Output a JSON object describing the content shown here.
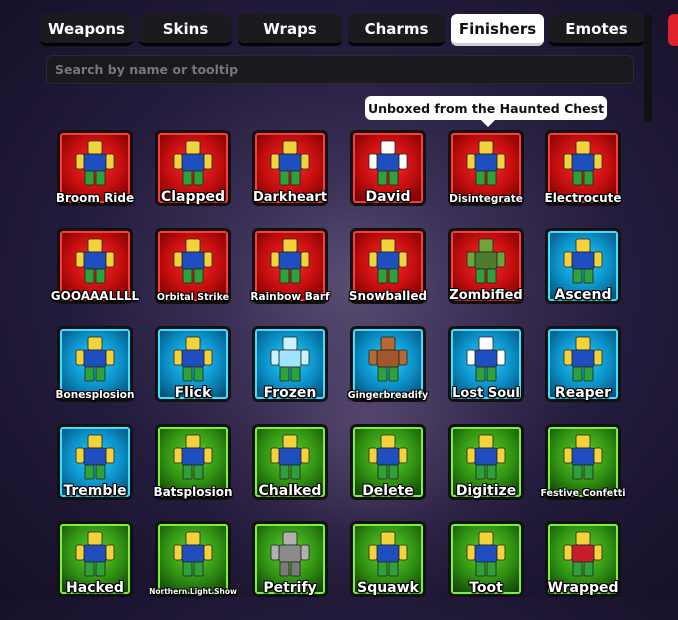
{
  "tabs": [
    {
      "label": "Weapons",
      "active": false
    },
    {
      "label": "Skins",
      "active": false
    },
    {
      "label": "Wraps",
      "active": false
    },
    {
      "label": "Charms",
      "active": false
    },
    {
      "label": "Finishers",
      "active": true
    },
    {
      "label": "Emotes",
      "active": false
    }
  ],
  "search": {
    "placeholder": "Search by name or tooltip",
    "value": ""
  },
  "tooltip": {
    "text": "Unboxed from the Haunted Chest"
  },
  "colors": {
    "red": "#c40e0e",
    "blue": "#0b8fc7",
    "green": "#2f8f12",
    "active_tab": "#ffffff",
    "tab": "#1b1b1f"
  },
  "finishers": [
    {
      "label": "Broom Ride",
      "rarity": "red",
      "icon": "broom-rider-icon"
    },
    {
      "label": "Clapped",
      "rarity": "red",
      "icon": "clapping-hands-icon"
    },
    {
      "label": "Darkheart",
      "rarity": "red",
      "icon": "dark-figure-icon"
    },
    {
      "label": "David",
      "rarity": "red",
      "icon": "snowman-icon"
    },
    {
      "label": "Disintegrate",
      "rarity": "red",
      "icon": "laser-blast-icon"
    },
    {
      "label": "Electrocute",
      "rarity": "red",
      "icon": "lightning-icon"
    },
    {
      "label": "GOOAAALLLL",
      "rarity": "red",
      "icon": "soccer-goal-icon"
    },
    {
      "label": "Orbital Strike",
      "rarity": "red",
      "icon": "orbital-beam-icon"
    },
    {
      "label": "Rainbow Barf",
      "rarity": "red",
      "icon": "rainbow-icon"
    },
    {
      "label": "Snowballed",
      "rarity": "red",
      "icon": "snowball-icon"
    },
    {
      "label": "Zombified",
      "rarity": "red",
      "icon": "zombie-icon"
    },
    {
      "label": "Ascend",
      "rarity": "blue",
      "icon": "ascend-light-icon"
    },
    {
      "label": "Bonesplosion",
      "rarity": "blue",
      "icon": "bones-icon"
    },
    {
      "label": "Flick",
      "rarity": "blue",
      "icon": "flick-hand-icon"
    },
    {
      "label": "Frozen",
      "rarity": "blue",
      "icon": "frozen-figure-icon"
    },
    {
      "label": "Gingerbreadify",
      "rarity": "blue",
      "icon": "gingerbread-icon"
    },
    {
      "label": "Lost Soul",
      "rarity": "blue",
      "icon": "ghost-icon"
    },
    {
      "label": "Reaper",
      "rarity": "blue",
      "icon": "scythe-icon"
    },
    {
      "label": "Tremble",
      "rarity": "blue",
      "icon": "trembling-figure-icon"
    },
    {
      "label": "Batsplosion",
      "rarity": "green",
      "icon": "bat-icon"
    },
    {
      "label": "Chalked",
      "rarity": "green",
      "icon": "chalk-outline-icon"
    },
    {
      "label": "Delete",
      "rarity": "green",
      "icon": "delete-menu-icon"
    },
    {
      "label": "Digitize",
      "rarity": "green",
      "icon": "digital-figure-icon"
    },
    {
      "label": "Festive Confetti",
      "rarity": "green",
      "icon": "confetti-icon"
    },
    {
      "label": "Hacked",
      "rarity": "green",
      "icon": "hacked-figure-icon"
    },
    {
      "label": "Northern Light Show",
      "rarity": "green",
      "icon": "aurora-icon"
    },
    {
      "label": "Petrify",
      "rarity": "green",
      "icon": "stone-figure-icon"
    },
    {
      "label": "Squawk",
      "rarity": "green",
      "icon": "bird-icon"
    },
    {
      "label": "Toot",
      "rarity": "green",
      "icon": "toot-cloud-icon"
    },
    {
      "label": "Wrapped",
      "rarity": "green",
      "icon": "gift-wrap-icon"
    }
  ]
}
